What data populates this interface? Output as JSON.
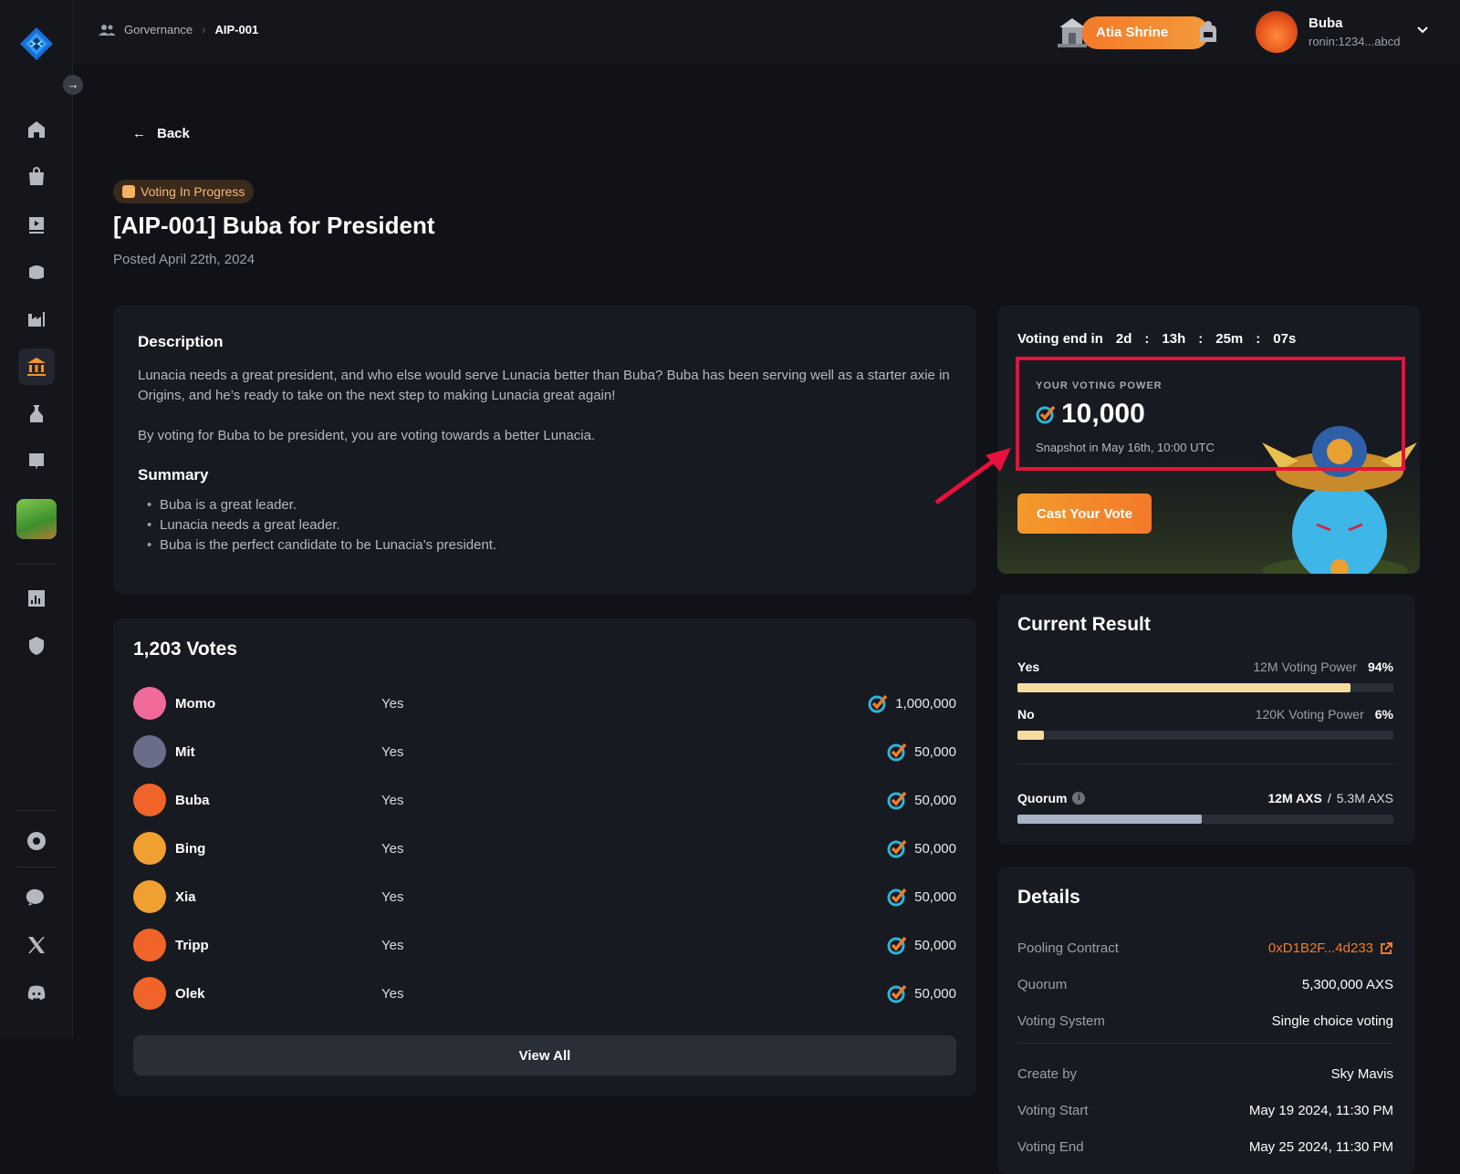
{
  "breadcrumb": {
    "section": "Gorvernance",
    "current": "AIP-001"
  },
  "header": {
    "shrine_label": "Atia Shrine",
    "user_name": "Buba",
    "user_address": "ronin:1234...abcd"
  },
  "back_label": "Back",
  "proposal": {
    "status": "Voting In Progress",
    "title": "[AIP-001] Buba for President",
    "posted": "Posted April 22th, 2024",
    "description_heading": "Description",
    "description_p1": "Lunacia needs a great president, and who else would serve Lunacia better than Buba? Buba has been serving well as a starter axie in Origins, and he’s ready to take on the next step to making Lunacia great again!",
    "description_p2": "By voting for Buba to be president, you are voting towards a better Lunacia.",
    "summary_heading": "Summary",
    "summary": [
      "Buba is a great leader.",
      "Lunacia needs a great leader.",
      "Buba is the perfect candidate to be Lunacia’s president."
    ]
  },
  "votes": {
    "title": "1,203 Votes",
    "rows": [
      {
        "name": "Momo",
        "choice": "Yes",
        "power": "1,000,000",
        "avatar_color": "#f06a9a"
      },
      {
        "name": "Mit",
        "choice": "Yes",
        "power": "50,000",
        "avatar_color": "#6a6d8a"
      },
      {
        "name": "Buba",
        "choice": "Yes",
        "power": "50,000",
        "avatar_color": "#f0642a"
      },
      {
        "name": "Bing",
        "choice": "Yes",
        "power": "50,000",
        "avatar_color": "#f0a030"
      },
      {
        "name": "Xia",
        "choice": "Yes",
        "power": "50,000",
        "avatar_color": "#f0a030"
      },
      {
        "name": "Tripp",
        "choice": "Yes",
        "power": "50,000",
        "avatar_color": "#f0642a"
      },
      {
        "name": "Olek",
        "choice": "Yes",
        "power": "50,000",
        "avatar_color": "#f0642a"
      }
    ],
    "view_all": "View All"
  },
  "voting_power": {
    "ends_label": "Voting end in",
    "days": "2d",
    "hours": "13h",
    "minutes": "25m",
    "seconds": "07s",
    "colon": ":",
    "label": "YOUR VOTING POWER",
    "value": "10,000",
    "snapshot": "Snapshot in May 16th, 10:00 UTC",
    "cast_label": "Cast Your Vote"
  },
  "result": {
    "title": "Current Result",
    "yes_label": "Yes",
    "yes_power": "12M Voting Power",
    "yes_pct": "94%",
    "yes_fill": 0.885,
    "no_label": "No",
    "no_power": "120K Voting Power",
    "no_pct": "6%",
    "no_fill": 0.07,
    "quorum_label": "Quorum",
    "quorum_value": "12M AXS",
    "quorum_slash": "/",
    "quorum_total": "5.3M AXS",
    "quorum_fill": 0.49
  },
  "details": {
    "title": "Details",
    "rows": [
      {
        "key": "Pooling Contract",
        "value": "0xD1B2F...4d233"
      },
      {
        "key": "Quorum",
        "value": "5,300,000 AXS"
      },
      {
        "key": "Voting System",
        "value": "Single choice voting"
      },
      {
        "key": "Create by",
        "value": "Sky Mavis"
      },
      {
        "key": "Voting Start",
        "value": "May 19 2024, 11:30 PM"
      },
      {
        "key": "Voting End",
        "value": "May 25 2024, 11:30 PM"
      }
    ]
  },
  "colors": {
    "accent": "#f37a2a",
    "highlight": "#e8103c",
    "yes_bar": "#f7dba0",
    "quorum_bar": "#a9b3c3"
  }
}
